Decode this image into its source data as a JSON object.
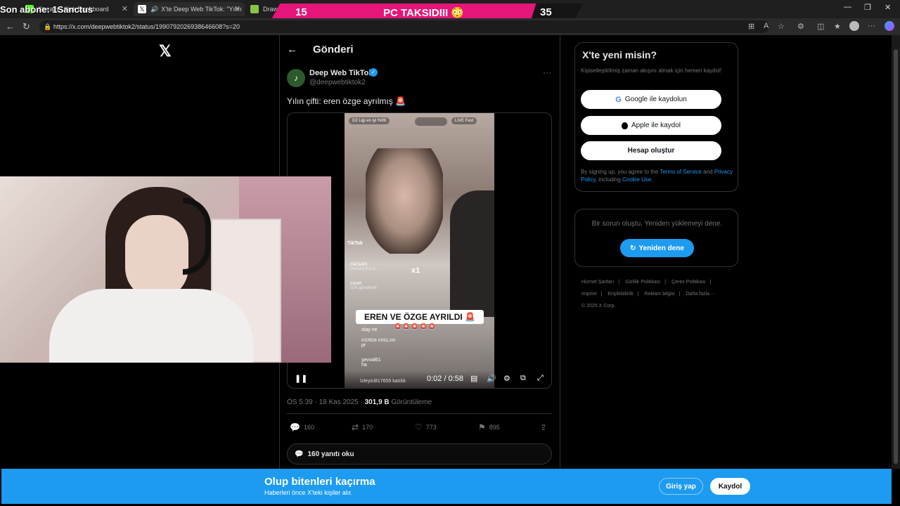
{
  "stream_overlay": {
    "last_sub_label": "Son abone: 1Sanctus",
    "score_left": "15",
    "score_title": "PC TAKSIDIII",
    "score_emoji": "😳",
    "score_right": "35"
  },
  "browser": {
    "tabs": [
      {
        "label": "Stream - Kick Dashboard",
        "color": "#53fc18"
      },
      {
        "label": "X'te Deep Web TikTok: \"Yılın",
        "color": "#ffffff"
      },
      {
        "label": "Draw It!",
        "color": "#8bc34a"
      }
    ],
    "url": "https://x.com/deepwebtiktok2/status/1990792026938646608?s=20"
  },
  "tweet": {
    "header_title": "Gönderi",
    "author_name": "Deep Web TikTok",
    "author_handle": "@deepwebtiktok2",
    "text": "Yılın çifti: eren özge ayrılmış 🚨",
    "meta_time": "ÖS 5:39 · 18 Kas 2025 · ",
    "meta_views": "301,9 B",
    "meta_views_label": " Görüntüleme",
    "replies": "160",
    "retweets": "170",
    "likes": "773",
    "bookmarks": "895",
    "read_replies": "160 yanıtı oku"
  },
  "video": {
    "top_left": "D2 Ligi en iyi %99",
    "top_right": "LIVE Fest",
    "tiktok_label": "TikTok",
    "caption": "EREN VE ÖZGE AYRILDI 🚨",
    "caption_sub": "🚨🚨🚨🚨🚨",
    "chat": [
      {
        "user": "HASAN",
        "msg": "Dondurma K..."
      },
      {
        "user": "civan",
        "msg": "Gift gönderdi"
      },
      {
        "user": "",
        "msg": "olay ne"
      },
      {
        "user": "KEREM ARSLAN",
        "msg": "pr"
      },
      {
        "user": "şevval61",
        "msg": "ha"
      }
    ],
    "join_text": "İzleyici817655 katıldı",
    "multiplier": "x1",
    "time": "0:02 / 0:58"
  },
  "sidebar": {
    "signup_title": "X'te yeni misin?",
    "signup_sub": "Kişiselleştirilmiş zaman akışını almak için hemen kaydol!",
    "google_btn": "Google ile kaydolun",
    "apple_btn": "Apple ile kaydol",
    "create_btn": "Hesap oluştur",
    "legal_pre": "By signing up, you agree to the ",
    "legal_terms": "Terms of Service",
    "legal_and": " and ",
    "legal_privacy": "Privacy Policy",
    "legal_including": ", including ",
    "legal_cookie": "Cookie Use.",
    "error_text": "Bir sorun oluştu. Yeniden yüklemeyi dene.",
    "retry_btn": "Yeniden dene",
    "footer": [
      "Hizmet Şartları",
      "|",
      "Gizlilik Politikası",
      "|",
      "Çerez Politikası",
      "|",
      "Imprint",
      "|",
      "Erişilebilirlik",
      "|",
      "Reklam bilgisi",
      "|",
      "Daha fazla ···",
      "© 2025 X Corp."
    ]
  },
  "bottom_banner": {
    "title": "Olup bitenleri kaçırma",
    "sub": "Haberleri önce X'teki kişiler alır.",
    "login": "Giriş yap",
    "signup": "Kaydol"
  }
}
